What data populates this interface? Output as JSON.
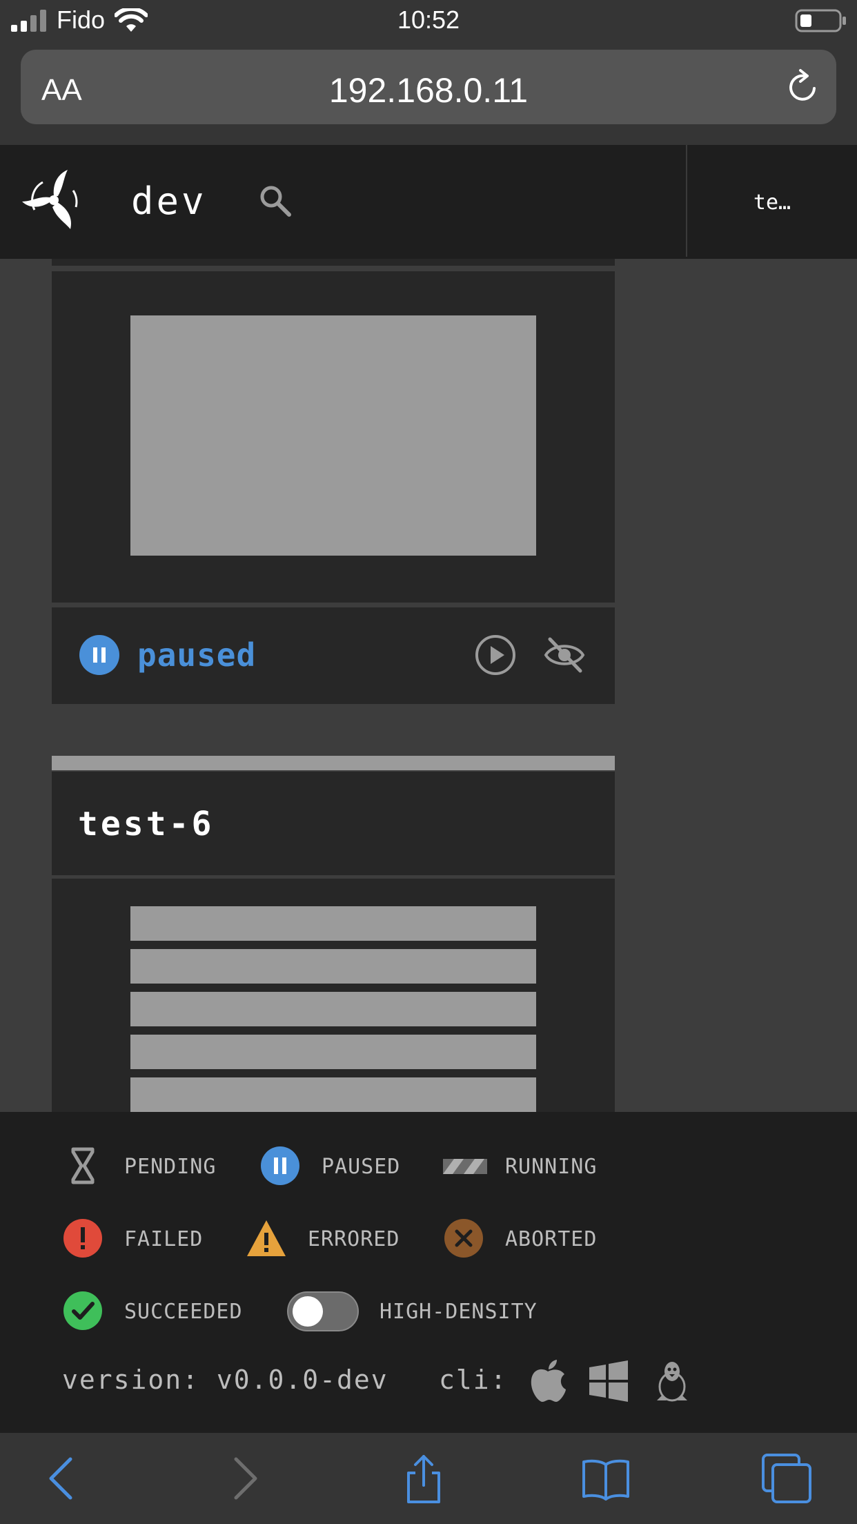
{
  "status_bar": {
    "carrier": "Fido",
    "time": "10:52"
  },
  "browser": {
    "text_size_label": "AA",
    "url": "192.168.0.11"
  },
  "topbar": {
    "pipeline_name": "dev",
    "team_label": "te…"
  },
  "cards": [
    {
      "status": "paused",
      "status_color": "#4a90d9"
    },
    {
      "title": "test-6",
      "job_bar_count": 5
    }
  ],
  "legend": {
    "items": [
      {
        "label": "PENDING",
        "icon": "hourglass-icon"
      },
      {
        "label": "PAUSED",
        "icon": "pause-icon",
        "color": "#4a90d9"
      },
      {
        "label": "RUNNING",
        "icon": "running-stripes-icon"
      },
      {
        "label": "FAILED",
        "icon": "exclamation-icon",
        "color": "#e04a3a"
      },
      {
        "label": "ERRORED",
        "icon": "warning-triangle-icon",
        "color": "#e6a23c"
      },
      {
        "label": "ABORTED",
        "icon": "x-circle-icon",
        "color": "#8b572a"
      },
      {
        "label": "SUCCEEDED",
        "icon": "check-icon",
        "color": "#3fbf5a"
      },
      {
        "label": "HIGH-DENSITY",
        "icon": "toggle",
        "on": false
      }
    ],
    "version": "version: v0.0.0-dev",
    "cli_label": "cli:",
    "cli_platforms": [
      "apple-icon",
      "windows-icon",
      "linux-icon"
    ]
  },
  "toolbar": {
    "buttons": [
      "back-icon",
      "forward-icon",
      "share-icon",
      "bookmarks-icon",
      "tabs-icon"
    ],
    "accent": "#4a8fe0"
  }
}
